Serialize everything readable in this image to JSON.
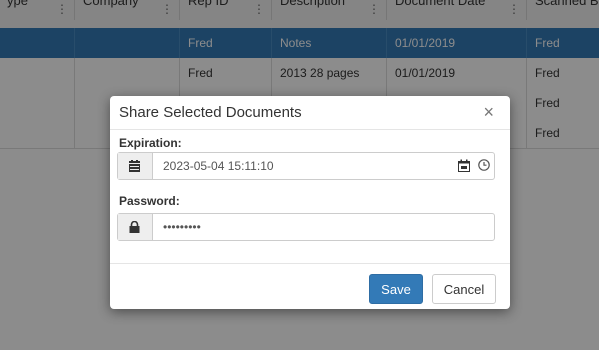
{
  "grid": {
    "columns": [
      {
        "label": "ype"
      },
      {
        "label": "Company"
      },
      {
        "label": "Rep ID"
      },
      {
        "label": "Description"
      },
      {
        "label": "Document Date"
      },
      {
        "label": "Scanned By"
      }
    ],
    "rows": [
      {
        "selected": true,
        "cells": [
          "",
          "",
          "Fred",
          "Notes",
          "01/01/2019",
          "Fred"
        ]
      },
      {
        "selected": false,
        "cells": [
          "",
          "",
          "Fred",
          "2013 28 pages",
          "01/01/2019",
          "Fred"
        ]
      },
      {
        "selected": false,
        "cells": [
          "",
          "",
          "",
          "",
          "",
          "Fred"
        ]
      },
      {
        "selected": false,
        "cells": [
          "",
          "",
          "",
          "",
          "",
          "Fred"
        ]
      }
    ],
    "menu_glyph": "⋮"
  },
  "modal": {
    "title": "Share Selected Documents",
    "close_glyph": "×",
    "expiration": {
      "label": "Expiration:",
      "value": "2023-05-04 15:11:10",
      "icons": [
        "calendar-icon",
        "calendar-picker-icon",
        "clock-icon"
      ]
    },
    "password": {
      "label": "Password:",
      "value": "xxxxxxxxx",
      "icon": "lock-icon"
    },
    "buttons": {
      "save": "Save",
      "cancel": "Cancel"
    }
  },
  "colors": {
    "primary": "#337ab7",
    "backdrop": "rgba(0,0,0,0.45)"
  }
}
